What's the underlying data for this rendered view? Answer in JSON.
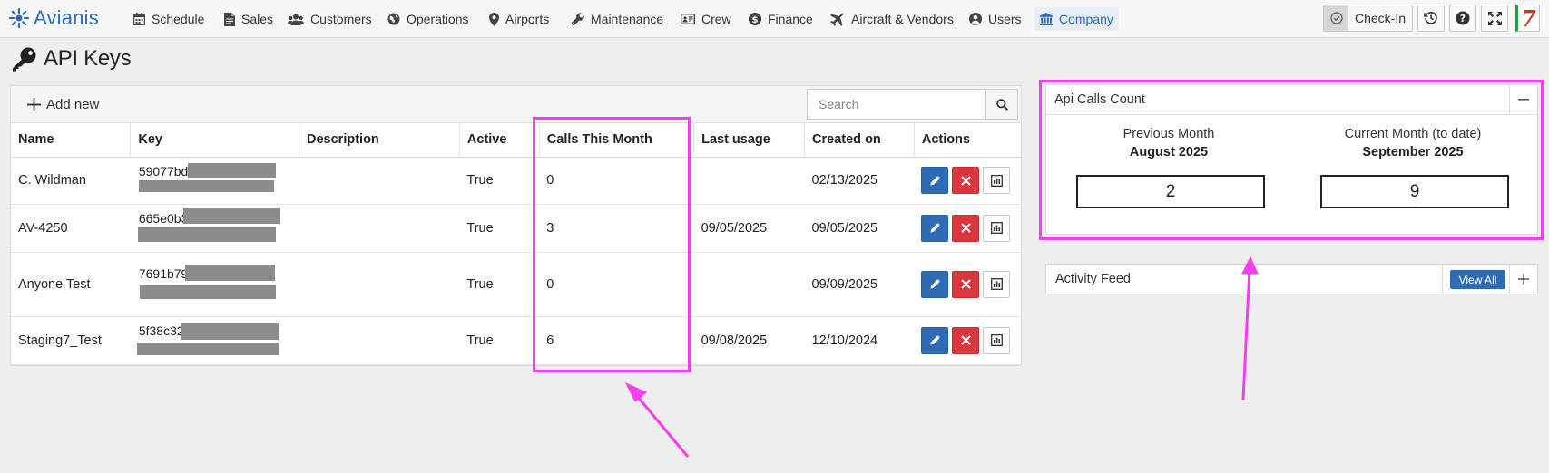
{
  "app": {
    "name": "Avianis"
  },
  "nav": {
    "items": [
      {
        "label": "Schedule",
        "icon": "calendar-icon"
      },
      {
        "label": "Sales",
        "icon": "document-icon"
      },
      {
        "label": "Customers",
        "icon": "users-icon"
      },
      {
        "label": "Operations",
        "icon": "globe-icon"
      },
      {
        "label": "Airports",
        "icon": "map-pin-icon"
      },
      {
        "label": "Maintenance",
        "icon": "wrench-icon"
      },
      {
        "label": "Crew",
        "icon": "id-card-icon"
      },
      {
        "label": "Finance",
        "icon": "dollar-icon"
      },
      {
        "label": "Aircraft & Vendors",
        "icon": "plane-icon"
      },
      {
        "label": "Users",
        "icon": "user-circle-icon"
      },
      {
        "label": "Company",
        "icon": "bank-icon",
        "active": true
      }
    ],
    "checkin_label": "Check-In",
    "tools": [
      "history-icon",
      "help-icon",
      "fullscreen-icon"
    ],
    "badge": "7"
  },
  "page": {
    "title": "API Keys"
  },
  "toolbar": {
    "add_new_label": "Add new",
    "search_placeholder": "Search"
  },
  "table": {
    "columns": [
      "Name",
      "Key",
      "Description",
      "Active",
      "Calls This Month",
      "Last usage",
      "Created on",
      "Actions"
    ],
    "rows": [
      {
        "name": "C. Wildman",
        "key": "59077bd",
        "description": "",
        "active": "True",
        "calls": "0",
        "last_usage": "",
        "created": "02/13/2025"
      },
      {
        "name": "AV-4250",
        "key": "665e0b3",
        "description": "",
        "active": "True",
        "calls": "3",
        "last_usage": "09/05/2025",
        "created": "09/05/2025"
      },
      {
        "name": "Anyone Test",
        "key": "7691b79",
        "description": "",
        "active": "True",
        "calls": "0",
        "last_usage": "",
        "created": "09/09/2025"
      },
      {
        "name": "Staging7_Test",
        "key": "5f38c32",
        "description": "",
        "active": "True",
        "calls": "6",
        "last_usage": "09/08/2025",
        "created": "12/10/2024"
      }
    ]
  },
  "api_calls_widget": {
    "title": "Api Calls Count",
    "previous": {
      "label": "Previous Month",
      "month": "August 2025",
      "count": "2"
    },
    "current": {
      "label": "Current Month (to date)",
      "month": "September 2025",
      "count": "9"
    }
  },
  "activity_feed": {
    "title": "Activity Feed",
    "view_all_label": "View All"
  },
  "colors": {
    "brand": "#2e6bb5",
    "danger": "#d9363e",
    "annotation": "#f43ef0"
  }
}
